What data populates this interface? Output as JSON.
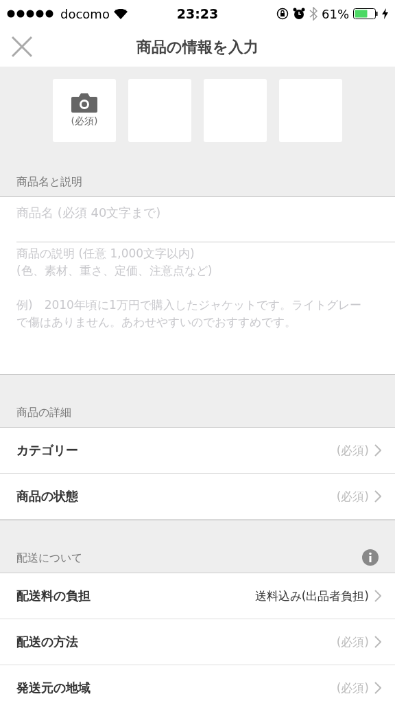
{
  "status_bar": {
    "carrier": "docomo",
    "time": "23:23",
    "battery": "61%"
  },
  "nav": {
    "title": "商品の情報を入力"
  },
  "photo_slots": [
    {
      "kind": "camera",
      "label": "(必須)"
    },
    {
      "kind": "empty"
    },
    {
      "kind": "empty"
    },
    {
      "kind": "empty"
    }
  ],
  "sections": [
    {
      "title": "商品名と説明",
      "kind": "fields",
      "fields": [
        {
          "kind": "line",
          "placeholder": "商品名 (必須 40文字まで)"
        },
        {
          "kind": "area",
          "placeholder": "商品の説明 (任意 1,000文字以内)\n(色、素材、重さ、定価、注意点など)\n\n例)　2010年頃に1万円で購入したジャケットです。ライトグレーで傷はありません。あわせやすいのでおすすめです。"
        }
      ]
    },
    {
      "title": "商品の詳細",
      "kind": "rows",
      "info": false,
      "rows": [
        {
          "label": "カテゴリー",
          "value": "(必須)",
          "kind": "hint"
        },
        {
          "label": "商品の状態",
          "value": "(必須)",
          "kind": "hint"
        }
      ]
    },
    {
      "title": "配送について",
      "kind": "rows",
      "info": true,
      "rows": [
        {
          "label": "配送料の負担",
          "value": "送料込み(出品者負担)",
          "kind": "value"
        },
        {
          "label": "配送の方法",
          "value": "(必須)",
          "kind": "hint"
        },
        {
          "label": "発送元の地域",
          "value": "(必須)",
          "kind": "hint"
        }
      ]
    }
  ]
}
